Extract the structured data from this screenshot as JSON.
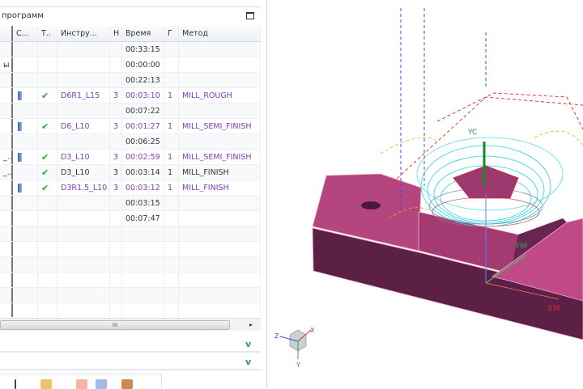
{
  "panel": {
    "title": "программ"
  },
  "columns": [
    "",
    "С...",
    "Т..",
    "Инстру...",
    "Н",
    "Время",
    "Г",
    "Метод"
  ],
  "rows": [
    {
      "name": "",
      "tool": "",
      "check": false,
      "instr": "",
      "n": "",
      "time": "00:33:15",
      "g": "",
      "method": "",
      "highlight": false
    },
    {
      "name": "ы",
      "tool": "",
      "check": false,
      "instr": "",
      "n": "",
      "time": "00:00:00",
      "g": "",
      "method": "",
      "highlight": false
    },
    {
      "name": "",
      "tool": "",
      "check": false,
      "instr": "",
      "n": "",
      "time": "00:22:13",
      "g": "",
      "method": "",
      "highlight": false
    },
    {
      "name": "",
      "tool": "y",
      "check": true,
      "instr": "D6R1_L15",
      "n": "3",
      "time": "00:03:10",
      "g": "1",
      "method": "MILL_ROUGH",
      "highlight": true
    },
    {
      "name": "",
      "tool": "",
      "check": false,
      "instr": "",
      "n": "",
      "time": "00:07:22",
      "g": "",
      "method": "",
      "highlight": false
    },
    {
      "name": "",
      "tool": "y",
      "check": true,
      "instr": "D6_L10",
      "n": "3",
      "time": "00:01:27",
      "g": "1",
      "method": "MILL_SEMI_FINISH",
      "highlight": true
    },
    {
      "name": "",
      "tool": "",
      "check": false,
      "instr": "",
      "n": "",
      "time": "00:06:25",
      "g": "",
      "method": "",
      "highlight": false
    },
    {
      "name": "_...",
      "tool": "y",
      "check": true,
      "instr": "D3_L10",
      "n": "3",
      "time": "00:02:59",
      "g": "1",
      "method": "MILL_SEMI_FINISH",
      "highlight": true
    },
    {
      "name": "_...",
      "tool": "",
      "check": true,
      "instr": "D3_L10",
      "n": "3",
      "time": "00:03:14",
      "g": "1",
      "method": "MILL_FINISH",
      "highlight": false
    },
    {
      "name": "",
      "tool": "y",
      "check": true,
      "instr": "D3R1.5_L10",
      "n": "3",
      "time": "00:03:12",
      "g": "1",
      "method": "MILL_FINISH",
      "highlight": true
    },
    {
      "name": "",
      "tool": "",
      "check": false,
      "instr": "",
      "n": "",
      "time": "00:03:15",
      "g": "",
      "method": "",
      "highlight": false
    },
    {
      "name": "",
      "tool": "",
      "check": false,
      "instr": "",
      "n": "",
      "time": "00:07:47",
      "g": "",
      "method": "",
      "highlight": false
    }
  ],
  "empty_rows": 6,
  "scrollbar": {
    "thumb_label": "III",
    "arrow": "▸"
  },
  "folds": [
    {
      "chevron": "v"
    },
    {
      "chevron": "v"
    }
  ],
  "viewport": {
    "labels": {
      "ym": "YM",
      "xm": "XM",
      "yc": "YC",
      "z": "Z",
      "x": "X",
      "y": "Y"
    }
  },
  "colors": {
    "part_top": "#b5457f",
    "part_front": "#5c1f46",
    "toolpath": "#22d4e0",
    "method_text": "#7a3fb5"
  }
}
